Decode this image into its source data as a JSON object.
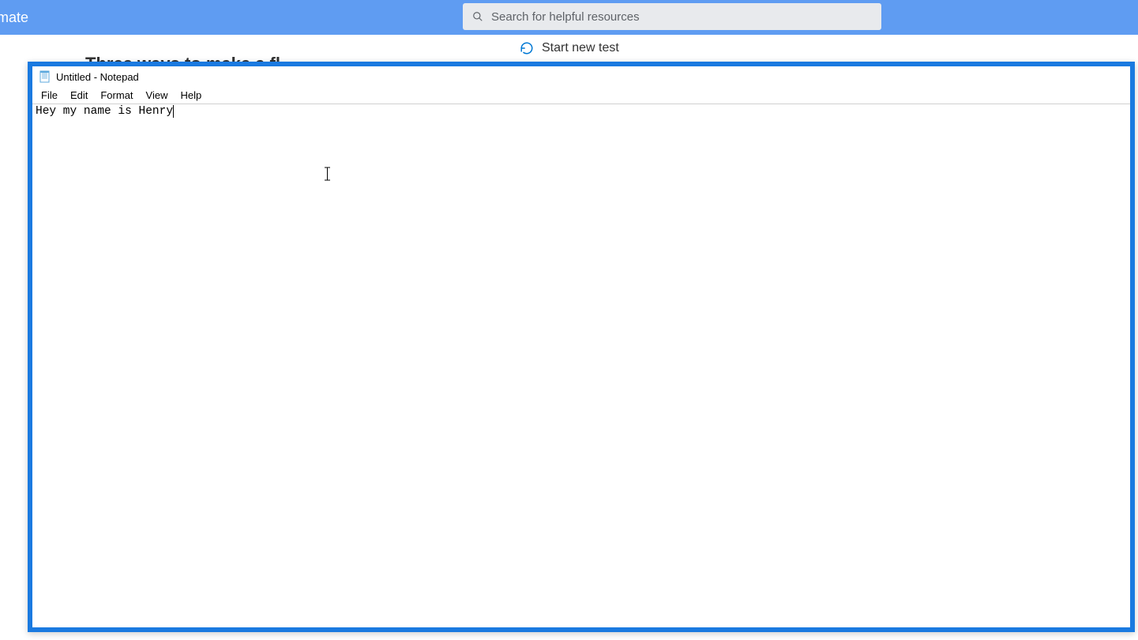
{
  "bg": {
    "app_title_fragment": "mate",
    "search_placeholder": "Search for helpful resources",
    "heading_fragment": "Three ways to make a fl",
    "start_new_test": "Start new test"
  },
  "notepad": {
    "title": "Untitled - Notepad",
    "menu": {
      "file": "File",
      "edit": "Edit",
      "format": "Format",
      "view": "View",
      "help": "Help"
    },
    "content": "Hey my name is Henry"
  }
}
